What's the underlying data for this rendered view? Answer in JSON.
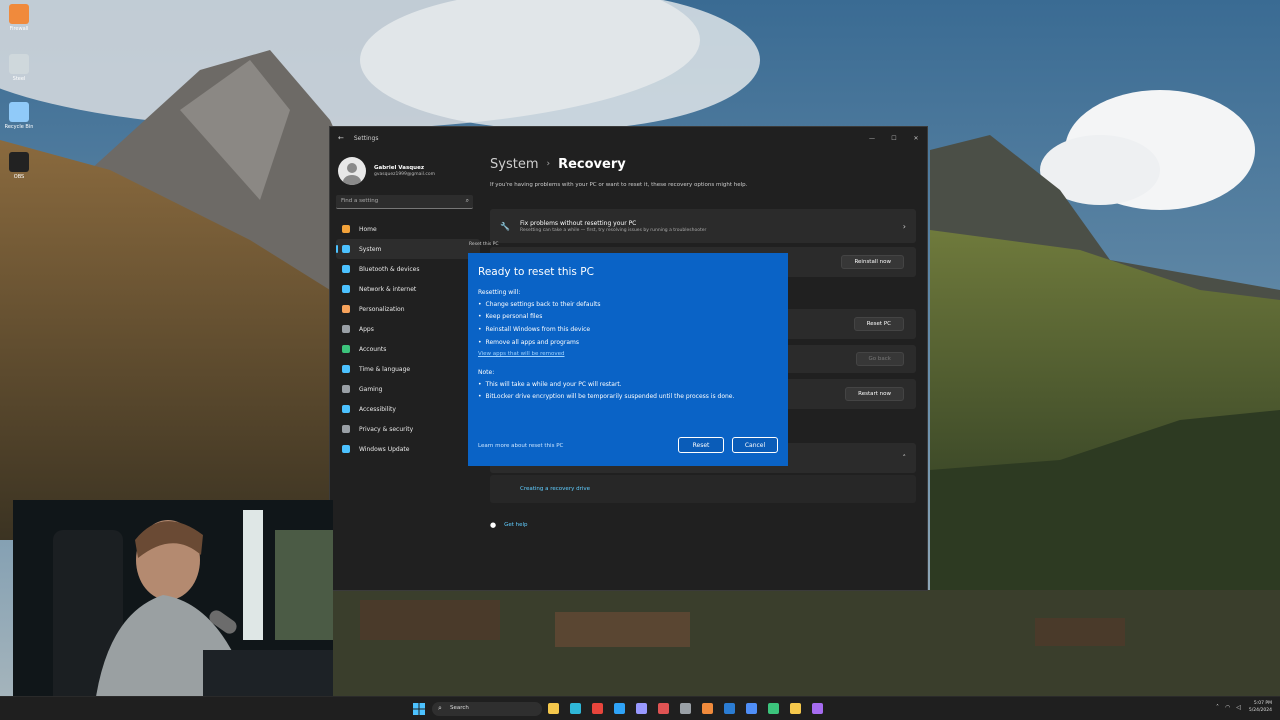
{
  "desktop": {
    "icons": [
      {
        "label": "Firewall",
        "color": "#f08a3c"
      },
      {
        "label": "Steel",
        "color": "#cfd8dc"
      },
      {
        "label": "Recycle Bin",
        "color": "#90caf9"
      },
      {
        "label": "OBS",
        "color": "#222222"
      }
    ]
  },
  "window": {
    "title": "Settings",
    "controls": [
      "—",
      "☐",
      "✕"
    ]
  },
  "profile": {
    "name": "Gabriel Vasquez",
    "email": "gvasquez1999@gmail.com"
  },
  "search": {
    "placeholder": "Find a setting"
  },
  "nav": [
    {
      "label": "Home",
      "icon": "home-icon",
      "color": "#f2a23a",
      "active": false
    },
    {
      "label": "System",
      "icon": "system-icon",
      "color": "#4cc2ff",
      "active": true
    },
    {
      "label": "Bluetooth & devices",
      "icon": "bluetooth-icon",
      "color": "#4cc2ff",
      "active": false
    },
    {
      "label": "Network & internet",
      "icon": "network-icon",
      "color": "#4cc2ff",
      "active": false
    },
    {
      "label": "Personalization",
      "icon": "brush-icon",
      "color": "#f7a35c",
      "active": false
    },
    {
      "label": "Apps",
      "icon": "apps-icon",
      "color": "#9aa0a6",
      "active": false
    },
    {
      "label": "Accounts",
      "icon": "accounts-icon",
      "color": "#3cc47c",
      "active": false
    },
    {
      "label": "Time & language",
      "icon": "globe-icon",
      "color": "#4cc2ff",
      "active": false
    },
    {
      "label": "Gaming",
      "icon": "gaming-icon",
      "color": "#9aa0a6",
      "active": false
    },
    {
      "label": "Accessibility",
      "icon": "accessibility-icon",
      "color": "#4cc2ff",
      "active": false
    },
    {
      "label": "Privacy & security",
      "icon": "shield-icon",
      "color": "#9aa0a6",
      "active": false
    },
    {
      "label": "Windows Update",
      "icon": "update-icon",
      "color": "#4cc2ff",
      "active": false
    }
  ],
  "page": {
    "breadcrumb_parent": "System",
    "breadcrumb_sep": "›",
    "title": "Recovery",
    "intro": "If you're having problems with your PC or want to reset it, these recovery options might help."
  },
  "cards": {
    "fix": {
      "title": "Fix problems without resetting your PC",
      "subtitle": "Resetting can take a while — first, try resolving issues by running a troubleshooter"
    },
    "reinstall_button": "Reinstall now",
    "reset_button": "Reset PC",
    "goback_button": "Go back",
    "restart_button": "Restart now",
    "recovery_drive_link": "Creating a recovery drive",
    "get_help": "Get help"
  },
  "dialog": {
    "caption": "Reset this PC",
    "title": "Ready to reset this PC",
    "resetting_label": "Resetting will:",
    "items": [
      "Change settings back to their defaults",
      "Keep personal files",
      "Reinstall Windows from this device",
      "Remove all apps and programs"
    ],
    "apps_link": "View apps that will be removed",
    "note_label": "Note:",
    "notes": [
      "This will take a while and your PC will restart.",
      "BitLocker drive encryption will be temporarily suspended until the process is done."
    ],
    "learn_more": "Learn more about reset this PC",
    "reset_button": "Reset",
    "cancel_button": "Cancel"
  },
  "taskbar": {
    "search_label": "Search",
    "apps": [
      {
        "name": "file-explorer-icon",
        "color": "#f5c84c"
      },
      {
        "name": "edge-icon",
        "color": "#2fb7d8"
      },
      {
        "name": "chrome-icon",
        "color": "#e8453c"
      },
      {
        "name": "photoshop-icon",
        "color": "#2fa3f7"
      },
      {
        "name": "premiere-icon",
        "color": "#9999ff"
      },
      {
        "name": "app-red-icon",
        "color": "#e05353"
      },
      {
        "name": "settings-gear-icon",
        "color": "#9aa0a6"
      },
      {
        "name": "app-orange-icon",
        "color": "#f08a3c"
      },
      {
        "name": "word-icon",
        "color": "#2b7cd3"
      },
      {
        "name": "app-blue-icon",
        "color": "#4f8ef7"
      },
      {
        "name": "app-green-icon",
        "color": "#3cc47c"
      },
      {
        "name": "app-yellow-icon",
        "color": "#f5c84c"
      },
      {
        "name": "app-purple-icon",
        "color": "#a66cf0"
      }
    ],
    "time": "5:07 PM",
    "date": "5/24/2024"
  }
}
